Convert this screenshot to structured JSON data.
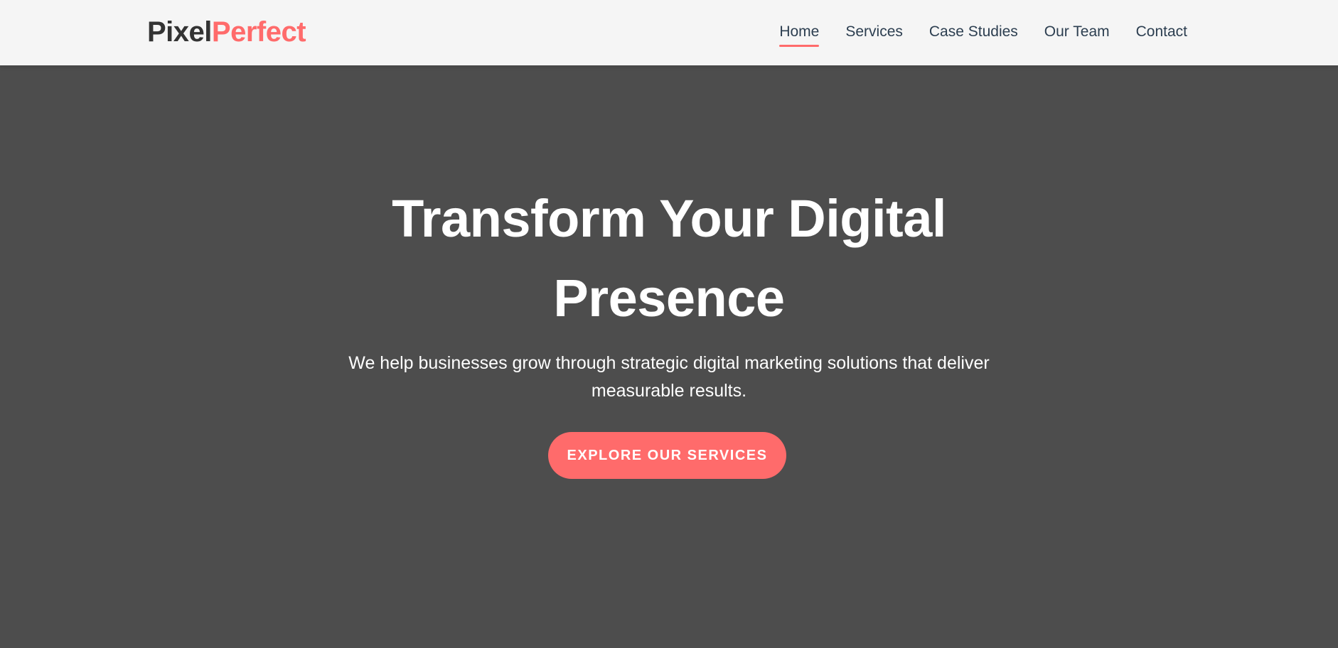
{
  "brand": {
    "name_part1": "Pixel",
    "name_part2": "Perfect",
    "accent_color": "#ff6b6b",
    "dark_color": "#333333"
  },
  "nav": {
    "items": [
      {
        "label": "Home",
        "active": true
      },
      {
        "label": "Services",
        "active": false
      },
      {
        "label": "Case Studies",
        "active": false
      },
      {
        "label": "Our Team",
        "active": false
      },
      {
        "label": "Contact",
        "active": false
      }
    ]
  },
  "hero": {
    "title": "Transform Your Digital Presence",
    "subtitle": "We help businesses grow through strategic digital marketing solutions that deliver measurable results.",
    "cta_label": "EXPLORE OUR SERVICES",
    "background_color": "#4d4d4d"
  }
}
